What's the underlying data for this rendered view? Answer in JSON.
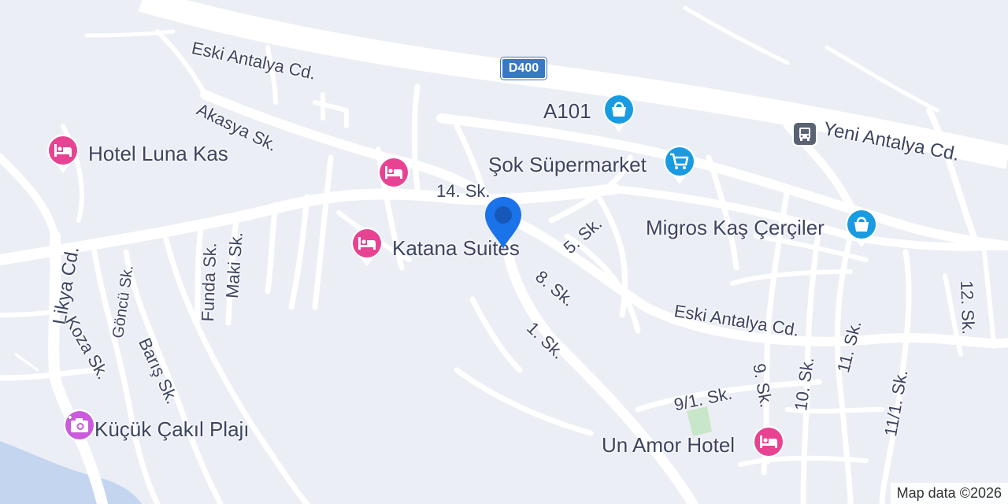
{
  "map": {
    "attribution": "Map data ©2026",
    "road_shield": "D400",
    "colors": {
      "land": "#eceef5",
      "road": "#ffffff",
      "water": "#c3d5ef",
      "park": "#c8e6c9",
      "hotel_marker": "#e84393",
      "shop_marker": "#1a9ae0",
      "attraction_marker": "#c95bdc",
      "pin": "#1a73e8",
      "label_text": "#3c4560"
    },
    "streets": {
      "eski_antalya_top": "Eski Antalya Cd.",
      "yeni_antalya": "Yeni Antalya Cd.",
      "akasya": "Akasya Sk.",
      "s14": "14. Sk.",
      "s5": "5. Sk.",
      "s8": "8. Sk.",
      "s1": "1. Sk.",
      "eski_antalya_bottom": "Eski Antalya Cd.",
      "likya": "Likya Cd.",
      "koza": "Koza Sk.",
      "goncu": "Göncü Sk.",
      "baris": "Barış Sk.",
      "funda": "Funda Sk.",
      "maki": "Maki Sk.",
      "s9_1": "9/1. Sk.",
      "s9": "9. Sk.",
      "s10": "10. Sk.",
      "s11": "11. Sk.",
      "s11_1": "11/1. Sk.",
      "s12": "12. Sk."
    },
    "pois": {
      "a101": {
        "name": "A101",
        "icon": "shopping-bag-icon"
      },
      "sok": {
        "name": "Şok Süpermarket",
        "icon": "shopping-cart-icon"
      },
      "migros": {
        "name": "Migros Kaş Çerçiler",
        "icon": "shopping-bag-icon"
      },
      "luna": {
        "name": "Hotel Luna Kas",
        "icon": "bed-icon"
      },
      "unnamed_hotel": {
        "name": "",
        "icon": "bed-icon"
      },
      "katana": {
        "name": "Katana Suites",
        "icon": "bed-icon"
      },
      "un_amor": {
        "name": "Un Amor Hotel",
        "icon": "bed-icon"
      },
      "cakil": {
        "name": "Küçük Çakıl Plajı",
        "icon": "camera-icon"
      }
    }
  }
}
